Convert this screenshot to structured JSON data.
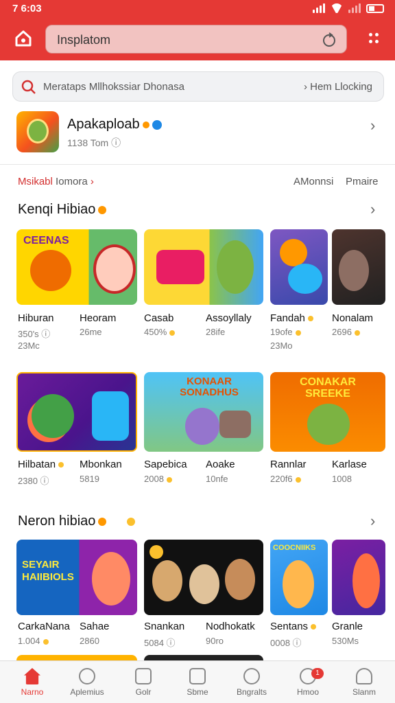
{
  "status": {
    "time": "7 6:03"
  },
  "topbar": {
    "search_text": "Insplatom"
  },
  "search": {
    "placeholder": "Merataps Mllhokssiar Dhonasa",
    "right_link": "Hem Llocking"
  },
  "featured": {
    "title": "Apakaploab",
    "subtitle": "1138 Tom"
  },
  "filters": {
    "tab_left": "Msikabl",
    "tab_left_more": "Iomora",
    "tab_mid": "AMonnsi",
    "tab_right": "Pmaire"
  },
  "sections": [
    {
      "title": "Kenqi Hibiao",
      "games": [
        {
          "name": "Hiburan",
          "meta": "350's",
          "meta2": "23Mc"
        },
        {
          "name": "Heoram",
          "meta": "26me"
        },
        {
          "name": "Casab",
          "meta": "450%"
        },
        {
          "name": "Assoyllaly",
          "meta": "28ife"
        },
        {
          "name": "Fandah",
          "meta": "19ofe",
          "meta2": "23Mo"
        },
        {
          "name": "Nonalam",
          "meta": "2696"
        }
      ]
    },
    {
      "title": "",
      "games": [
        {
          "name": "Hilbatan",
          "meta": "2380"
        },
        {
          "name": "Mbonkan",
          "meta": "5819"
        },
        {
          "name": "Sapebica",
          "meta": "2008"
        },
        {
          "name": "Aoake",
          "meta": "10nfe"
        },
        {
          "name": "Rannlar",
          "meta": "220f6"
        },
        {
          "name": "Karlase",
          "meta": "1008"
        }
      ],
      "banner_texts": [
        "KONAAR SONADHUS",
        "CONAKAR SREEKE"
      ]
    },
    {
      "title": "Neron hibiao",
      "games": [
        {
          "name": "CarkaNana",
          "meta": "1.004"
        },
        {
          "name": "Sahae",
          "meta": "2860"
        },
        {
          "name": "Snankan",
          "meta": "5084"
        },
        {
          "name": "Nodhokatk",
          "meta": "90ro"
        },
        {
          "name": "Sentans",
          "meta": "0008"
        },
        {
          "name": "Granle",
          "meta": "530Ms"
        }
      ],
      "banner_texts": [
        "SEYAIR HAIIBIOLS",
        "COOCNIIKS"
      ]
    }
  ],
  "nav": [
    {
      "label": "Narno",
      "icon": "home-icon"
    },
    {
      "label": "Aplemius",
      "icon": "search-icon"
    },
    {
      "label": "Golr",
      "icon": "folder-icon"
    },
    {
      "label": "Sbme",
      "icon": "game-icon"
    },
    {
      "label": "Bngralts",
      "icon": "edit-icon"
    },
    {
      "label": "Hmoo",
      "icon": "compass-icon",
      "badge": "1"
    },
    {
      "label": "Slanm",
      "icon": "user-icon"
    }
  ],
  "colors": {
    "accent": "#e53935"
  }
}
